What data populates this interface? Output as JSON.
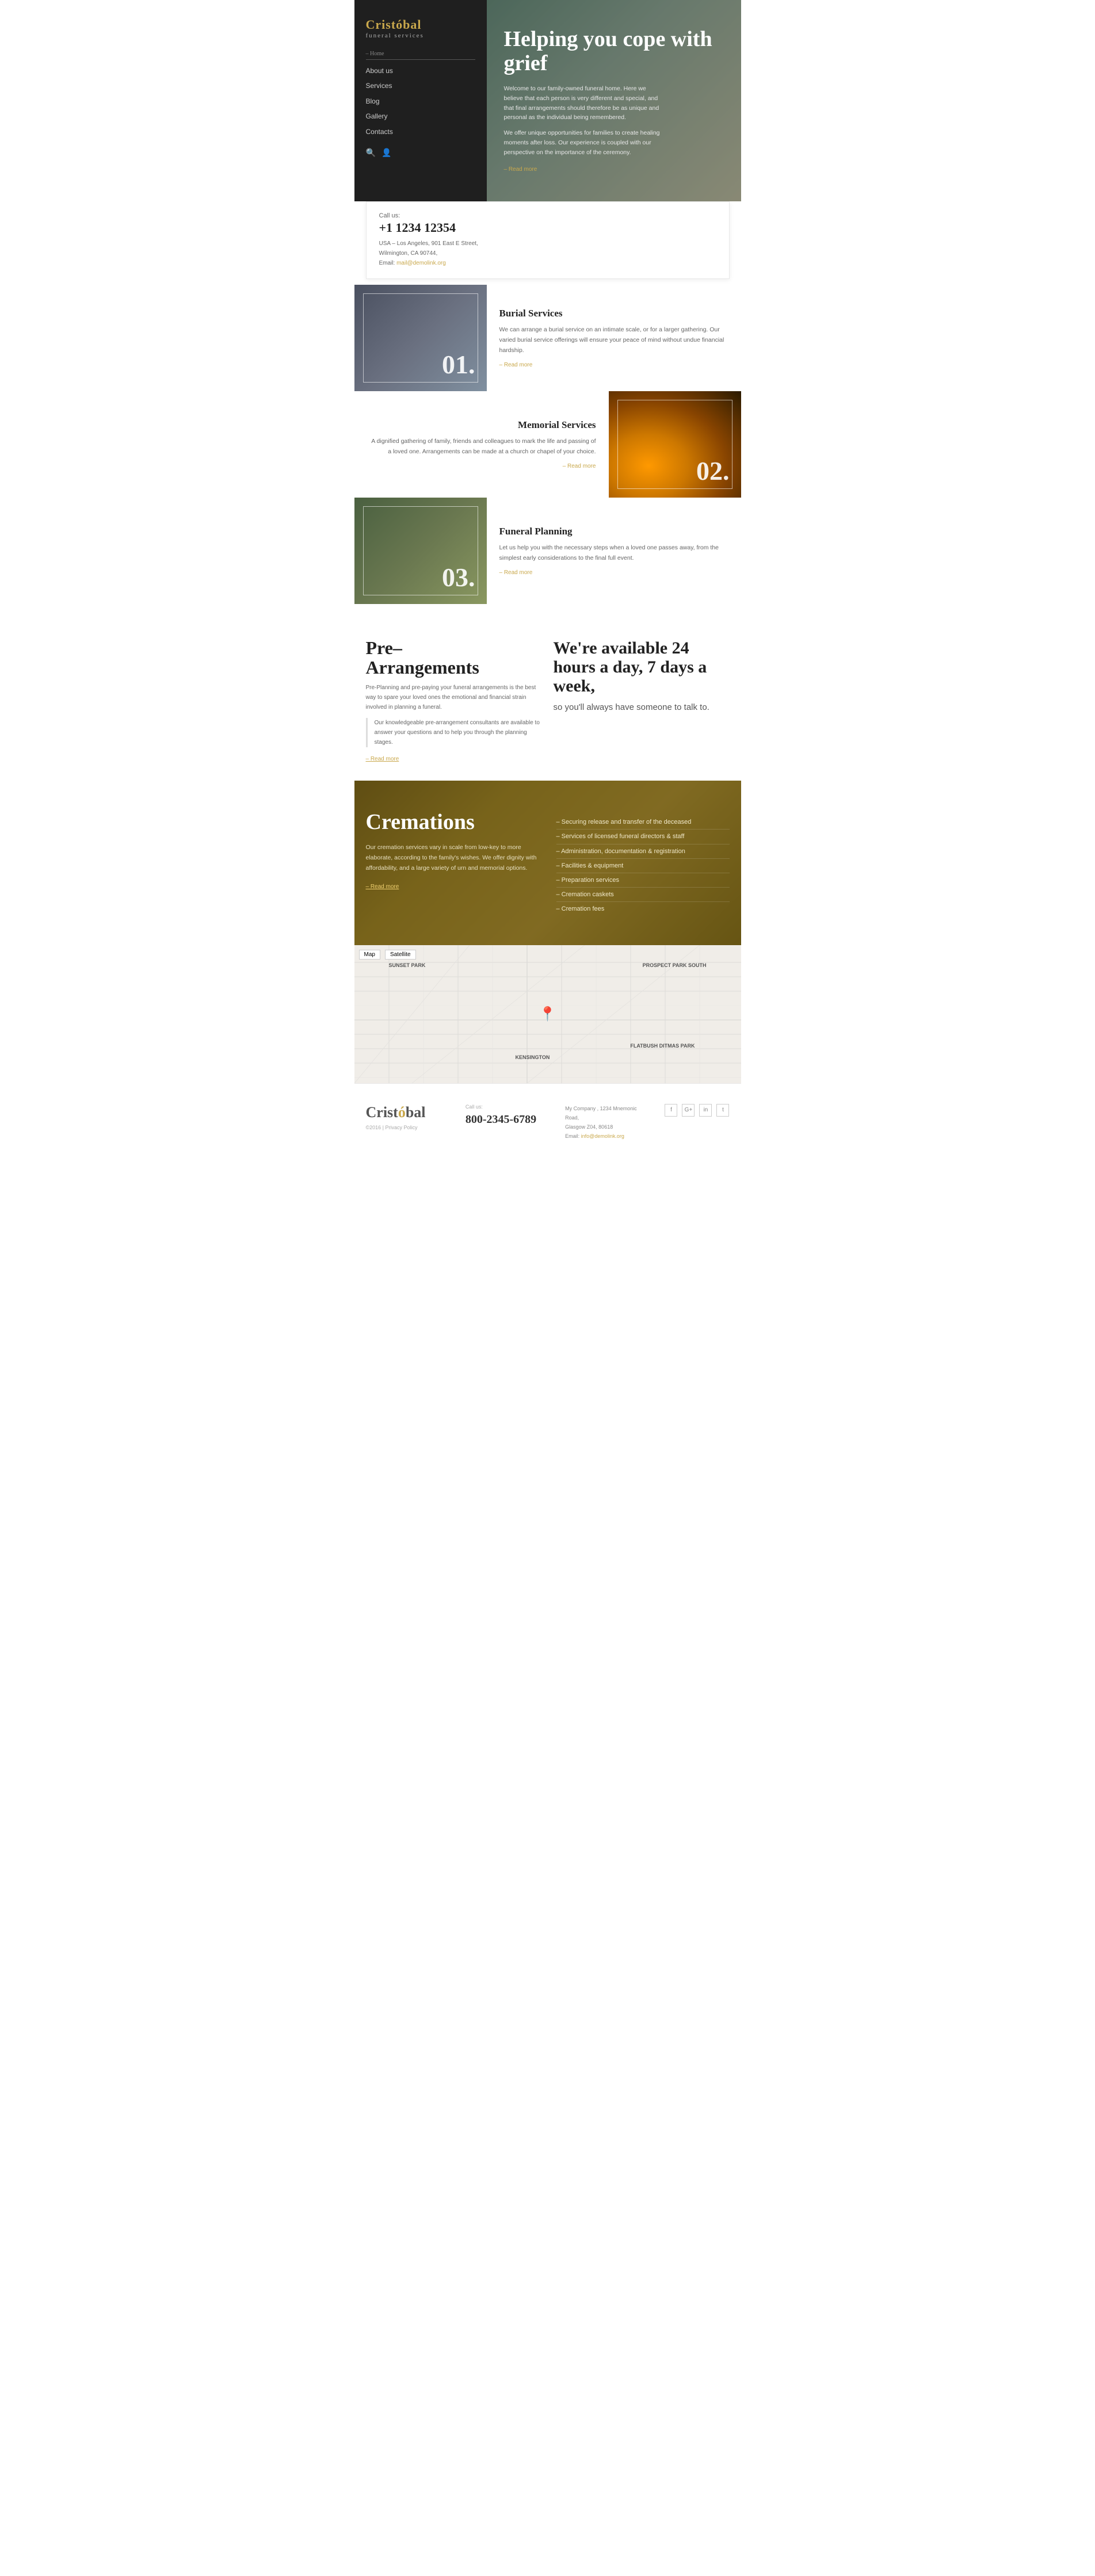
{
  "brand": {
    "name_part1": "Crist",
    "accent": "ó",
    "name_part2": "bal",
    "tagline": "funeral services"
  },
  "nav": {
    "home_label": "– Home",
    "items": [
      {
        "label": "About us",
        "href": "#"
      },
      {
        "label": "Services",
        "href": "#"
      },
      {
        "label": "Blog",
        "href": "#"
      },
      {
        "label": "Gallery",
        "href": "#"
      },
      {
        "label": "Contacts",
        "href": "#"
      }
    ]
  },
  "hero": {
    "title": "Helping you cope with grief",
    "para1": "Welcome to our family-owned funeral home. Here we believe that each person is very different and special, and that final arrangements should therefore be as unique and personal as the individual being remembered.",
    "para2": "We offer unique opportunities for families to create healing moments after loss. Our experience is coupled with our perspective on the importance of the ceremony.",
    "read_more": "– Read more"
  },
  "contact": {
    "call_label": "Call us:",
    "phone": "+1 1234 12354",
    "address_line1": "USA – Los Angeles, 901 East E Street,",
    "address_line2": "Wilmington, CA 90744,",
    "email_label": "Email:",
    "email": "mail@demolink.org"
  },
  "services": [
    {
      "number": "01.",
      "title": "Burial Services",
      "description": "We can arrange a burial service on an intimate scale, or for a larger gathering. Our varied burial service offerings will ensure your peace of mind without undue financial hardship.",
      "read_more": "– Read more",
      "image_class": "img-burial"
    },
    {
      "number": "02.",
      "title": "Memorial Services",
      "description": "A dignified gathering of family, friends and colleagues to mark the life and passing of a loved one. Arrangements can be made at a church or chapel of your choice.",
      "read_more": "– Read more",
      "image_class": "img-planning"
    },
    {
      "number": "03.",
      "title": "Funeral Planning",
      "description": "Let us help you with the necessary steps when a loved one passes away, from the simplest early considerations to the final full event.",
      "read_more": "– Read more",
      "image_class": "img-prearrange"
    }
  ],
  "pre_arrangements": {
    "title_line1": "Pre–",
    "title_line2": "Arrangements",
    "para": "Pre-Planning and pre-paying your funeral arrangements is the best way to spare your loved ones the emotional and financial strain involved in planning a funeral.",
    "indent": "Our knowledgeable pre-arrangement consultants are available to answer your questions and to help you through the planning stages.",
    "read_more": "– Read more"
  },
  "availability": {
    "title": "We're available 24 hours a day, 7 days a week,",
    "subtitle": "so you'll always have someone to talk to."
  },
  "cremations": {
    "title": "Cremations",
    "para": "Our cremation services vary in scale from low-key to more elaborate, according to the family's wishes. We offer dignity with affordability, and a large variety of urn and memorial options.",
    "read_more": "– Read more",
    "features": [
      "– Securing release and transfer of the deceased",
      "– Services of licensed funeral directors & staff",
      "– Administration, documentation & registration",
      "– Facilities & equipment",
      "– Preparation services",
      "– Cremation caskets",
      "– Cremation fees"
    ]
  },
  "map": {
    "toggle_map": "Map",
    "toggle_satellite": "Satellite",
    "areas": [
      "SUNSET PARK",
      "PROSPECT PARK SOUTH",
      "FLATBUSH DITMAS PARK",
      "KENSINGTON"
    ]
  },
  "footer": {
    "logo_name": "Cristóbal",
    "copy": "©2016 | Privacy Policy",
    "call_label": "Call us:",
    "phone": "800-2345-6789",
    "address": "My Company , 1234 Mnemonic Road,\nGlasgow Z04, 80618\nEmail: info@demolink.org",
    "social": [
      {
        "icon": "f",
        "name": "facebook"
      },
      {
        "icon": "G+",
        "name": "google-plus"
      },
      {
        "icon": "in",
        "name": "linkedin"
      },
      {
        "icon": "t",
        "name": "twitter"
      }
    ]
  }
}
